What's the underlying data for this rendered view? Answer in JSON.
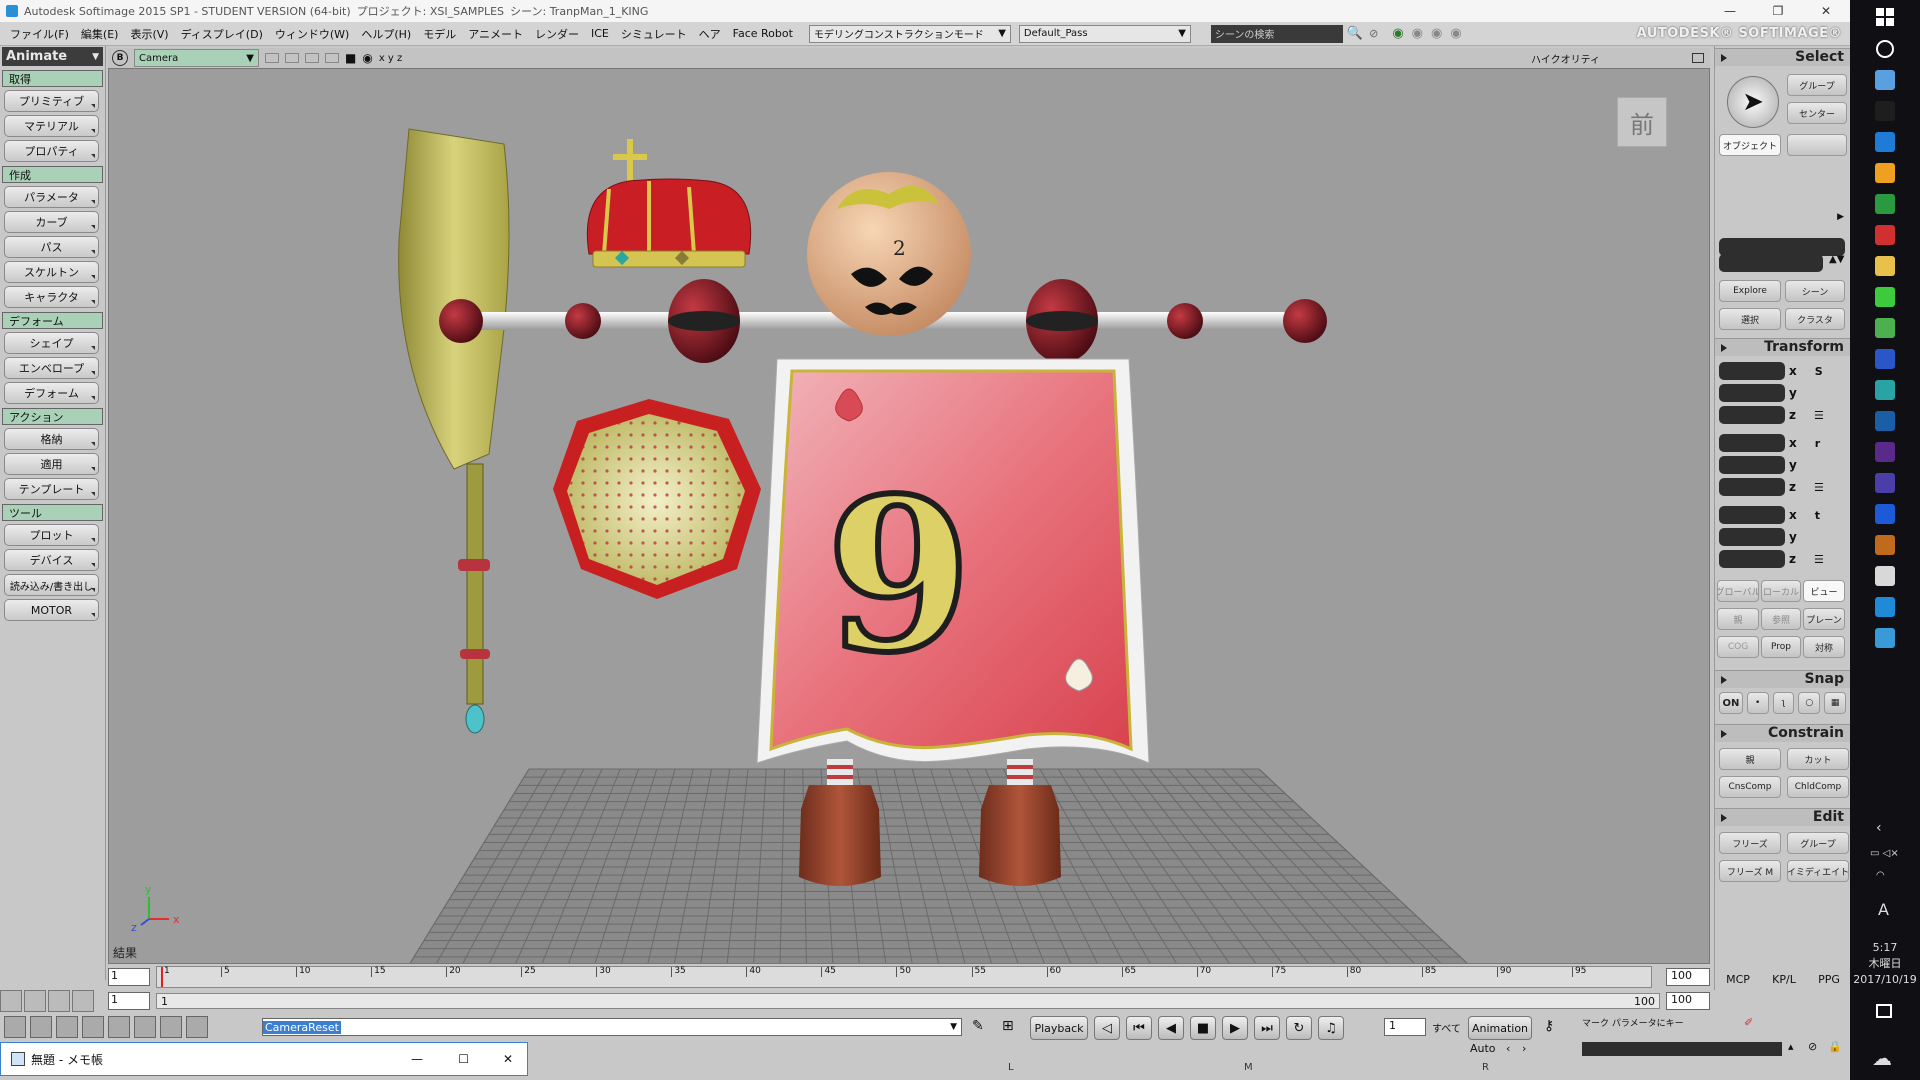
{
  "titlebar": {
    "app": "Autodesk Softimage 2015 SP1 - STUDENT VERSION (64-bit)",
    "project": "プロジェクト: XSI_SAMPLES",
    "scene": "シーン: TranpMan_1_KING",
    "minimize": "—",
    "restore": "❐",
    "close": "✕"
  },
  "menubar": {
    "items": [
      "ファイル(F)",
      "編集(E)",
      "表示(V)",
      "ディスプレイ(D)",
      "ウィンドウ(W)",
      "ヘルプ(H)",
      "モデル",
      "アニメート",
      "レンダー",
      "ICE",
      "シミュレート",
      "ヘア",
      "Face Robot"
    ],
    "construction_mode": "モデリングコンストラクションモード",
    "pass": "Default_Pass",
    "scene_search_placeholder": "シーンの検索",
    "brand": "AUTODESK® SOFTIMAGE®"
  },
  "left_panel": {
    "mode": "Animate",
    "sections": [
      {
        "header": "取得",
        "buttons": [
          "プリミティブ",
          "マテリアル",
          "プロパティ"
        ]
      },
      {
        "header": "作成",
        "buttons": [
          "パラメータ",
          "カーブ",
          "パス",
          "スケルトン",
          "キャラクタ"
        ]
      },
      {
        "header": "デフォーム",
        "buttons": [
          "シェイプ",
          "エンベロープ",
          "デフォーム"
        ]
      },
      {
        "header": "アクション",
        "buttons": [
          "格納",
          "適用",
          "テンプレート"
        ]
      },
      {
        "header": "ツール",
        "buttons": [
          "プロット",
          "デバイス",
          "読み込み/書き出し",
          "MOTOR"
        ]
      }
    ]
  },
  "viewport": {
    "view_letter": "B",
    "camera": "Camera",
    "axes_label": "x y z",
    "quality": "ハイクオリティ",
    "front_badge": "前",
    "result_label": "結果",
    "card_number": "9",
    "axis_x": "x",
    "axis_y": "y",
    "axis_z": "z"
  },
  "right_panel": {
    "select": {
      "title": "Select",
      "group": "グループ",
      "center": "センター",
      "object": "オブジェクト",
      "explore": "Explore",
      "scene": "シーン",
      "selection": "選択",
      "cluster": "クラスタ"
    },
    "transform": {
      "title": "Transform",
      "rows": [
        "x",
        "y",
        "z"
      ],
      "global": "グローバル",
      "local": "ローカル",
      "view": "ビュー",
      "par": "親",
      "ref": "参照",
      "plane": "プレーン",
      "cog": "COG",
      "prop": "Prop",
      "sym": "対称"
    },
    "snap": {
      "title": "Snap",
      "on": "ON"
    },
    "constrain": {
      "title": "Constrain",
      "parent": "親",
      "cut": "カット",
      "cnscomp": "CnsComp",
      "chldcomp": "ChldComp"
    },
    "edit": {
      "title": "Edit",
      "freeze": "フリーズ",
      "group": "グループ",
      "freeze_m": "フリーズ M",
      "immediate": "イミディエイト"
    },
    "tabs": [
      "MCP",
      "KP/L",
      "PPG"
    ]
  },
  "timeline": {
    "start": "1",
    "end": "100",
    "current_frame": "1",
    "range_start": "1",
    "range_end": "100",
    "ticks": [
      "1",
      "5",
      "10",
      "15",
      "20",
      "25",
      "30",
      "35",
      "40",
      "45",
      "50",
      "55",
      "60",
      "65",
      "70",
      "75",
      "80",
      "85",
      "90",
      "95"
    ]
  },
  "bottom": {
    "command": "CameraReset",
    "playback": "Playback",
    "frame_field": "1",
    "all": "すべて",
    "animation": "Animation",
    "auto": "Auto",
    "mark_params": "マーク パラメータにキー",
    "mouse_l": "L",
    "mouse_m": "M",
    "mouse_r": "R"
  },
  "notepad": {
    "title": "無題 - メモ帳",
    "minimize": "—",
    "maximize": "☐",
    "close": "✕"
  },
  "taskbar": {
    "time": "5:17",
    "day": "木曜日",
    "date": "2017/10/19",
    "ime": "A"
  },
  "colors": {
    "viewport_bg": "#9d9d9d",
    "section_header": "#a9d1b7",
    "card_red": "#e0525b",
    "crown_red": "#c81e24",
    "gold": "#cdb84e"
  }
}
